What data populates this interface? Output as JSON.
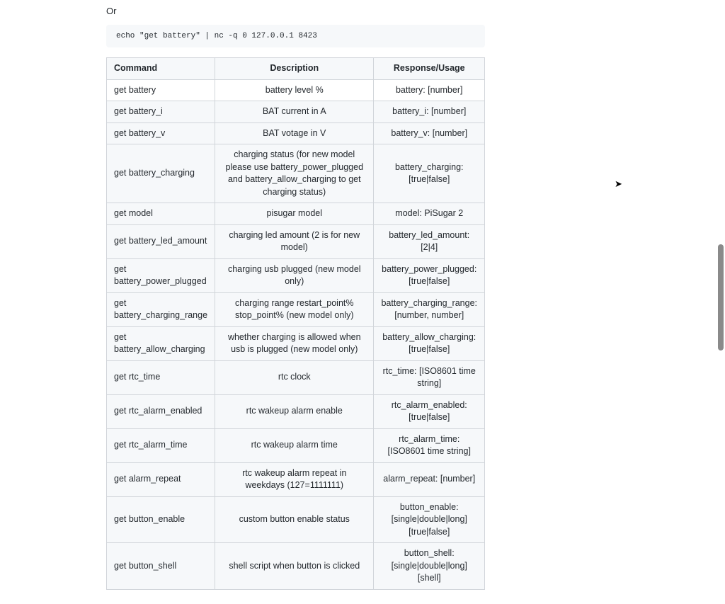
{
  "or_label": "Or",
  "code_line": "echo \"get battery\" | nc -q 0 127.0.0.1 8423",
  "table": {
    "headers": [
      "Command",
      "Description",
      "Response/Usage"
    ],
    "rows": [
      [
        "get battery",
        "battery level %",
        "battery: [number]"
      ],
      [
        "get battery_i",
        "BAT current in A",
        "battery_i: [number]"
      ],
      [
        "get battery_v",
        "BAT votage in V",
        "battery_v: [number]"
      ],
      [
        "get battery_charging",
        "charging status (for new model please use battery_power_plugged and battery_allow_charging to get charging status)",
        "battery_charging: [true|false]"
      ],
      [
        "get model",
        "pisugar model",
        "model: PiSugar 2"
      ],
      [
        "get battery_led_amount",
        "charging led amount (2 is for new model)",
        "battery_led_amount: [2|4]"
      ],
      [
        "get battery_power_plugged",
        "charging usb plugged (new model only)",
        "battery_power_plugged: [true|false]"
      ],
      [
        "get battery_charging_range",
        "charging range restart_point% stop_point% (new model only)",
        "battery_charging_range: [number, number]"
      ],
      [
        "get battery_allow_charging",
        "whether charging is allowed when usb is plugged (new model only)",
        "battery_allow_charging: [true|false]"
      ],
      [
        "get rtc_time",
        "rtc clock",
        "rtc_time: [ISO8601 time string]"
      ],
      [
        "get rtc_alarm_enabled",
        "rtc wakeup alarm enable",
        "rtc_alarm_enabled: [true|false]"
      ],
      [
        "get rtc_alarm_time",
        "rtc wakeup alarm time",
        "rtc_alarm_time: [ISO8601 time string]"
      ],
      [
        "get alarm_repeat",
        "rtc wakeup alarm repeat in weekdays (127=1111111)",
        "alarm_repeat: [number]"
      ],
      [
        "get button_enable",
        "custom button enable status",
        "button_enable: [single|double|long] [true|false]"
      ],
      [
        "get button_shell",
        "shell script when button is clicked",
        "button_shell: [single|double|long] [shell]"
      ]
    ]
  }
}
